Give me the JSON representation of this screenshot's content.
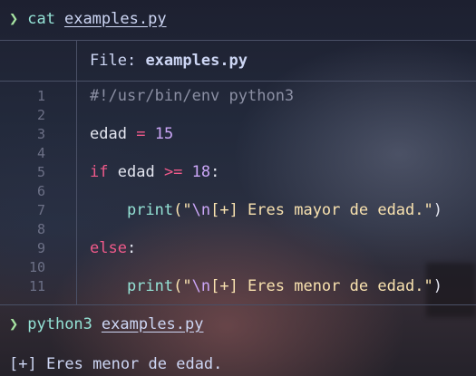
{
  "terminal": {
    "prompt1": {
      "arrow": "❯",
      "command": "cat",
      "argument": "examples.py"
    },
    "file_header": {
      "label": "File:",
      "filename": "examples.py"
    },
    "line_numbers": [
      "1",
      "2",
      "3",
      "4",
      "5",
      "6",
      "7",
      "8",
      "9",
      "10",
      "11"
    ],
    "code": {
      "shebang": "#!/usr/bin/env python3",
      "line3": {
        "var": "edad",
        "op": "=",
        "num": "15"
      },
      "line5": {
        "kw": "if",
        "var": "edad",
        "op": ">=",
        "num": "18",
        "colon": ":"
      },
      "line7": {
        "fn": "print",
        "open": "(\"",
        "esc": "\\n",
        "text": "[+] Eres mayor de edad.\"",
        "close": ")"
      },
      "line9": {
        "kw": "else",
        "colon": ":"
      },
      "line11": {
        "fn": "print",
        "open": "(\"",
        "esc": "\\n",
        "text": "[+] Eres menor de edad.\"",
        "close": ")"
      }
    },
    "prompt2": {
      "arrow": "❯",
      "command": "python3",
      "argument": "examples.py"
    },
    "output": "[+] Eres menor de edad."
  },
  "colors": {
    "prompt_arrow": "#a6e3a1",
    "command": "#94e2d5",
    "keyword": "#f05a8a",
    "number": "#cba6f7",
    "string": "#f9e2af",
    "comment": "#8b8fa3"
  }
}
